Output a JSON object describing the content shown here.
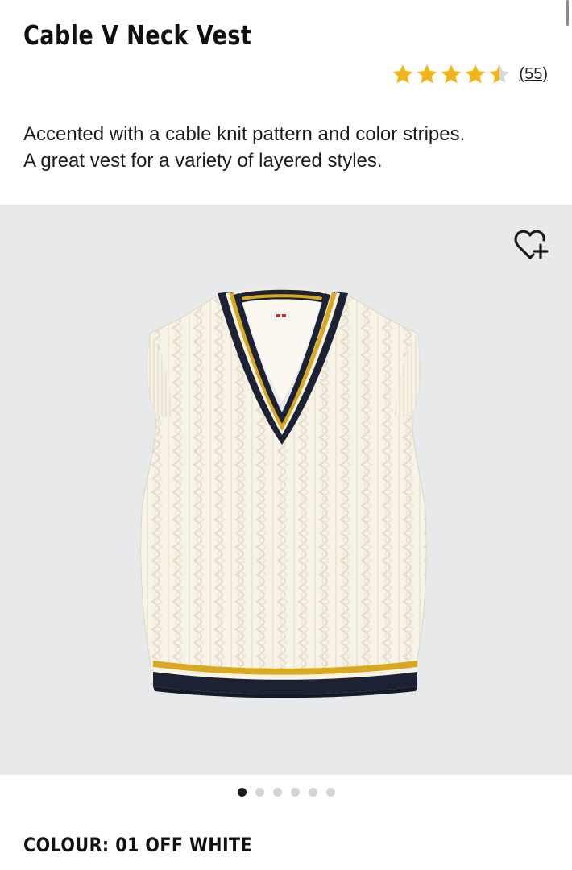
{
  "product": {
    "title": "Cable V Neck Vest",
    "rating": {
      "stars": 4.5,
      "max": 5,
      "count_label": "(55)",
      "star_color": "#f0b619"
    },
    "description_lines": [
      "Accented with a cable knit pattern and color stripes.",
      "A great vest for a variety of layered styles."
    ],
    "image": {
      "icon": "heart-plus-icon",
      "background": "#e8e9eb",
      "vest_colors": {
        "body": "#f7f3e7",
        "navy": "#1c2233",
        "gold": "#d8a921"
      }
    },
    "gallery": {
      "total": 6,
      "active_index": 0
    },
    "colour_label": "COLOUR: 01 OFF WHITE"
  }
}
